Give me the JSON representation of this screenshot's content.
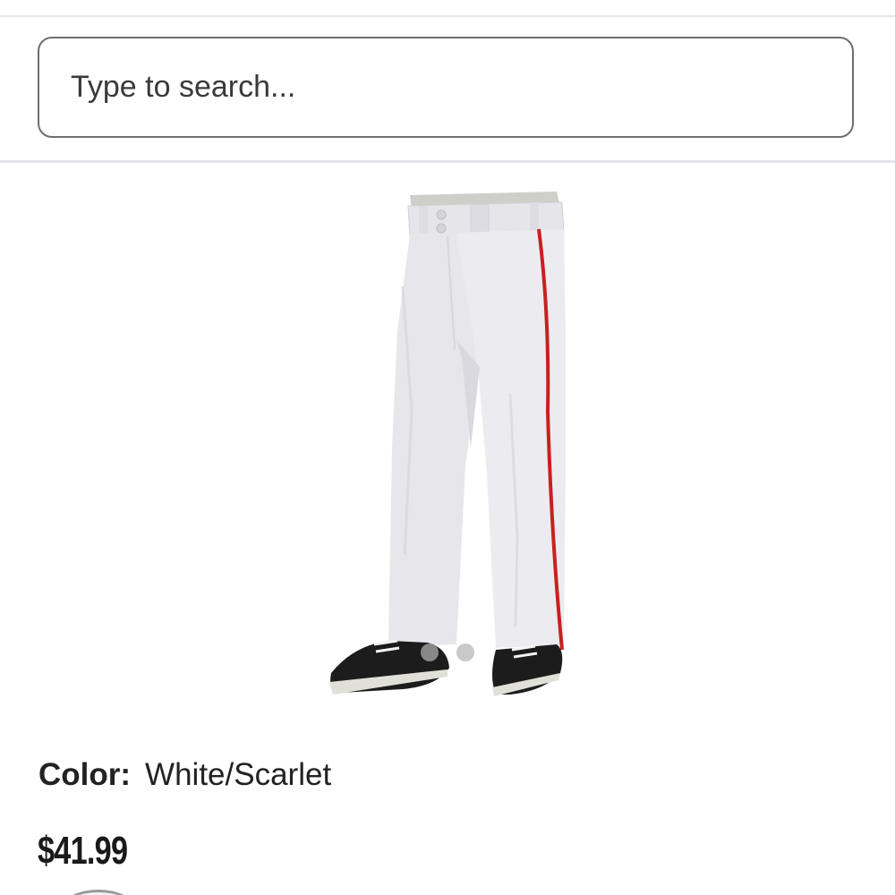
{
  "search": {
    "placeholder": "Type to search..."
  },
  "product": {
    "image_name": "baseball-pants-white-scarlet",
    "carousel": {
      "total": 2,
      "active_index": 0
    },
    "color_label": "Color:",
    "color_value": "White/Scarlet",
    "price": "$41.99"
  },
  "colors": {
    "pants": "#e9e9ee",
    "piping": "#c8201f",
    "shoe": "#1c1c1c",
    "dot_active": "#888888",
    "dot_inactive": "#c9c9c9"
  }
}
